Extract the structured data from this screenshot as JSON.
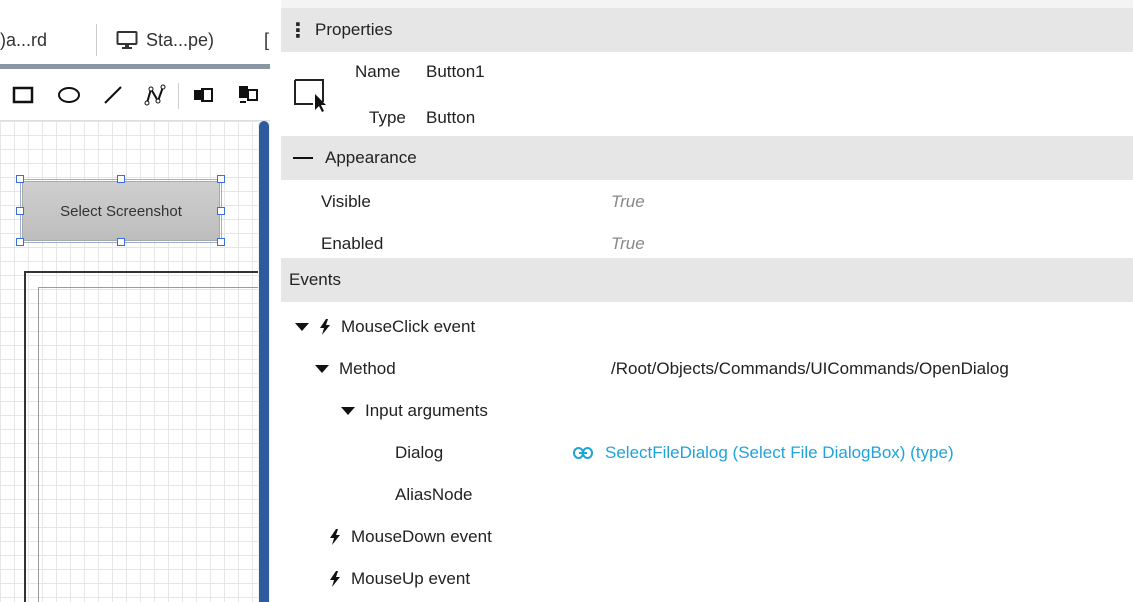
{
  "editor": {
    "tabs": [
      {
        "label": ")a...rd"
      },
      {
        "label": "Sta...pe)"
      },
      {
        "label": "["
      }
    ],
    "toolbar_icons": [
      "rectangle-icon",
      "ellipse-icon",
      "line-icon",
      "polyline-icon",
      "group-icon",
      "ungroup-icon"
    ],
    "canvas_button_label": "Select Screenshot"
  },
  "properties": {
    "title": "Properties",
    "object": {
      "name_label": "Name",
      "name_value": "Button1",
      "type_label": "Type",
      "type_value": "Button"
    },
    "appearance": {
      "header": "Appearance",
      "rows": [
        {
          "label": "Visible",
          "value": "True"
        },
        {
          "label": "Enabled",
          "value": "True"
        }
      ]
    },
    "events": {
      "header": "Events",
      "mouse_click": "MouseClick event",
      "method_label": "Method",
      "method_value": "/Root/Objects/Commands/UICommands/OpenDialog",
      "input_arguments": "Input arguments",
      "dialog_label": "Dialog",
      "dialog_value": "SelectFileDialog (Select File DialogBox) (type)",
      "alias_label": "AliasNode",
      "mouse_down": "MouseDown event",
      "mouse_up": "MouseUp event"
    }
  },
  "colors": {
    "header_bg": "#e6e6e6",
    "link": "#1fa3d9",
    "muted_value": "#888888",
    "scroll_thumb": "#2e5b9e"
  }
}
